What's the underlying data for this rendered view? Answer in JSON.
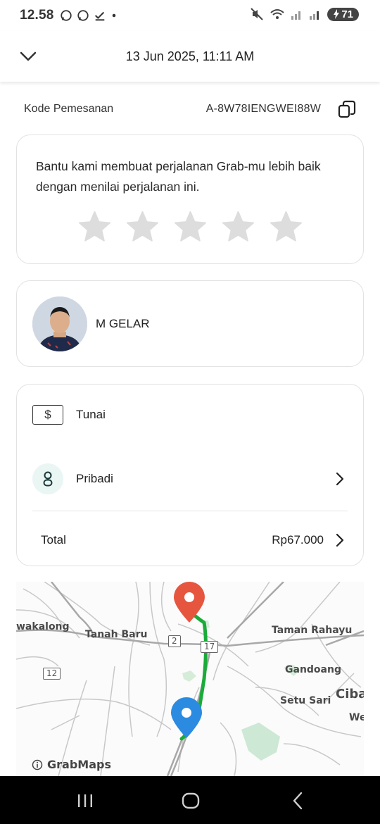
{
  "status_bar": {
    "time": "12.58",
    "battery": "71"
  },
  "header": {
    "title": "13 Jun 2025, 11:11 AM"
  },
  "booking": {
    "label": "Kode Pemesanan",
    "code": "A-8W78IENGWEI88W"
  },
  "rating": {
    "prompt": "Bantu kami membuat perjalanan Grab-mu lebih baik dengan menilai perjalanan ini.",
    "stars_selected": 0,
    "stars_total": 5
  },
  "driver": {
    "name": "M GELAR"
  },
  "payment": {
    "cash_symbol": "$",
    "method": "Tunai",
    "profile": "Pribadi",
    "total_label": "Total",
    "total_value": "Rp67.000"
  },
  "map": {
    "labels": [
      "wakalong",
      "Tanah Baru",
      "Taman Rahayu",
      "Gandoang",
      "Setu Sari",
      "Ciba",
      "We"
    ],
    "road_badges": [
      "2",
      "17",
      "12"
    ],
    "credit": "GrabMaps",
    "route_color": "#1aab3a",
    "origin_pin_color": "#2b8be0",
    "destination_pin_color": "#e6553e"
  }
}
